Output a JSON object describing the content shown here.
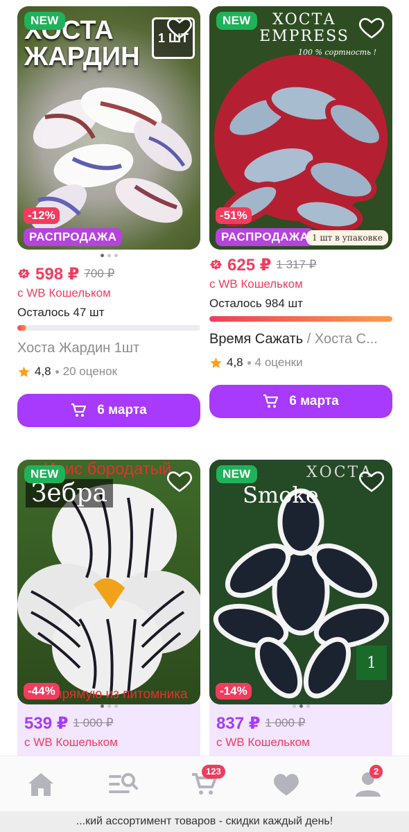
{
  "products": [
    {
      "badge_new": "NEW",
      "discount": "-12%",
      "sale_label": "РАСПРОДАЖА",
      "photo_title": "ХОСТА ЖАРДИН",
      "photo_qty": "1 ШТ",
      "price": "598 ₽",
      "old_price": "700 ₽",
      "wallet": "с WB Кошельком",
      "stock": "Осталось 47 шт",
      "stock_fraction": 0.05,
      "brand": "",
      "name": "Хоста Жардин 1шт",
      "rating": "4,8",
      "reviews": "20 оценок",
      "button": "6 марта"
    },
    {
      "badge_new": "NEW",
      "discount": "-51%",
      "sale_label": "РАСПРОДАЖА",
      "photo_title": "ХОСТА EMPRESS",
      "photo_sub": "100 % сортность !",
      "pack_label": "1 шт в упаковке",
      "price": "625 ₽",
      "old_price": "1 317 ₽",
      "wallet": "с WB Кошельком",
      "stock": "Осталось 984 шт",
      "stock_fraction": 1.0,
      "brand": "Время Сажать",
      "name": " / Хоста С...",
      "rating": "4,8",
      "reviews": "4 оценки",
      "button": "6 марта"
    },
    {
      "badge_new": "NEW",
      "discount": "-44%",
      "photo_title": "Зебра",
      "photo_top": "Ирис бородатый",
      "photo_bottom": "Напрямую из питомника",
      "price": "539 ₽",
      "old_price": "1 000 ₽",
      "wallet": "с WB Кошельком"
    },
    {
      "badge_new": "NEW",
      "discount": "-14%",
      "photo_title": "Smoke",
      "photo_top": "ХОСТА",
      "price": "837 ₽",
      "old_price": "1 000 ₽",
      "wallet": "с WB Кошельком"
    }
  ],
  "nav": {
    "cart_count": "123",
    "profile_count": "2"
  },
  "footer_text": "...кий ассортимент товаров - скидки каждый день!",
  "colors": {
    "accent": "#a73afd",
    "price_red": "#f23c5d",
    "new_green": "#1fb25a",
    "sale_purple": "#b444dc"
  }
}
